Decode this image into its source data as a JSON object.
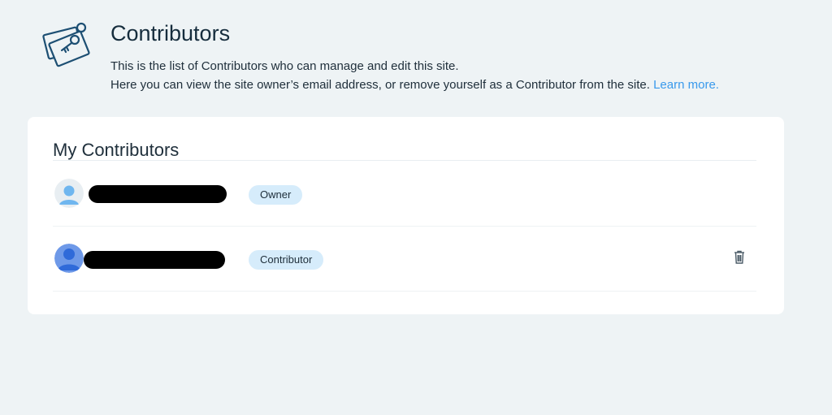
{
  "header": {
    "title": "Contributors",
    "description_line1": "This is the list of Contributors who can manage and edit this site.",
    "description_line2": "Here you can view the site owner’s email address, or remove yourself as a Contributor from the site.",
    "learn_more": "Learn more.",
    "icon": "key-card-icon"
  },
  "card": {
    "title": "My Contributors",
    "rows": [
      {
        "role": "Owner",
        "avatar_icon": "user-avatar-icon",
        "name_redacted": true,
        "deletable": false
      },
      {
        "role": "Contributor",
        "avatar_icon": "user-avatar-icon",
        "name_redacted": true,
        "deletable": true
      }
    ],
    "delete_icon": "trash-icon"
  },
  "colors": {
    "background": "#eef3f5",
    "card": "#ffffff",
    "accent_link": "#3899ec",
    "badge": "#d6ecfb"
  }
}
